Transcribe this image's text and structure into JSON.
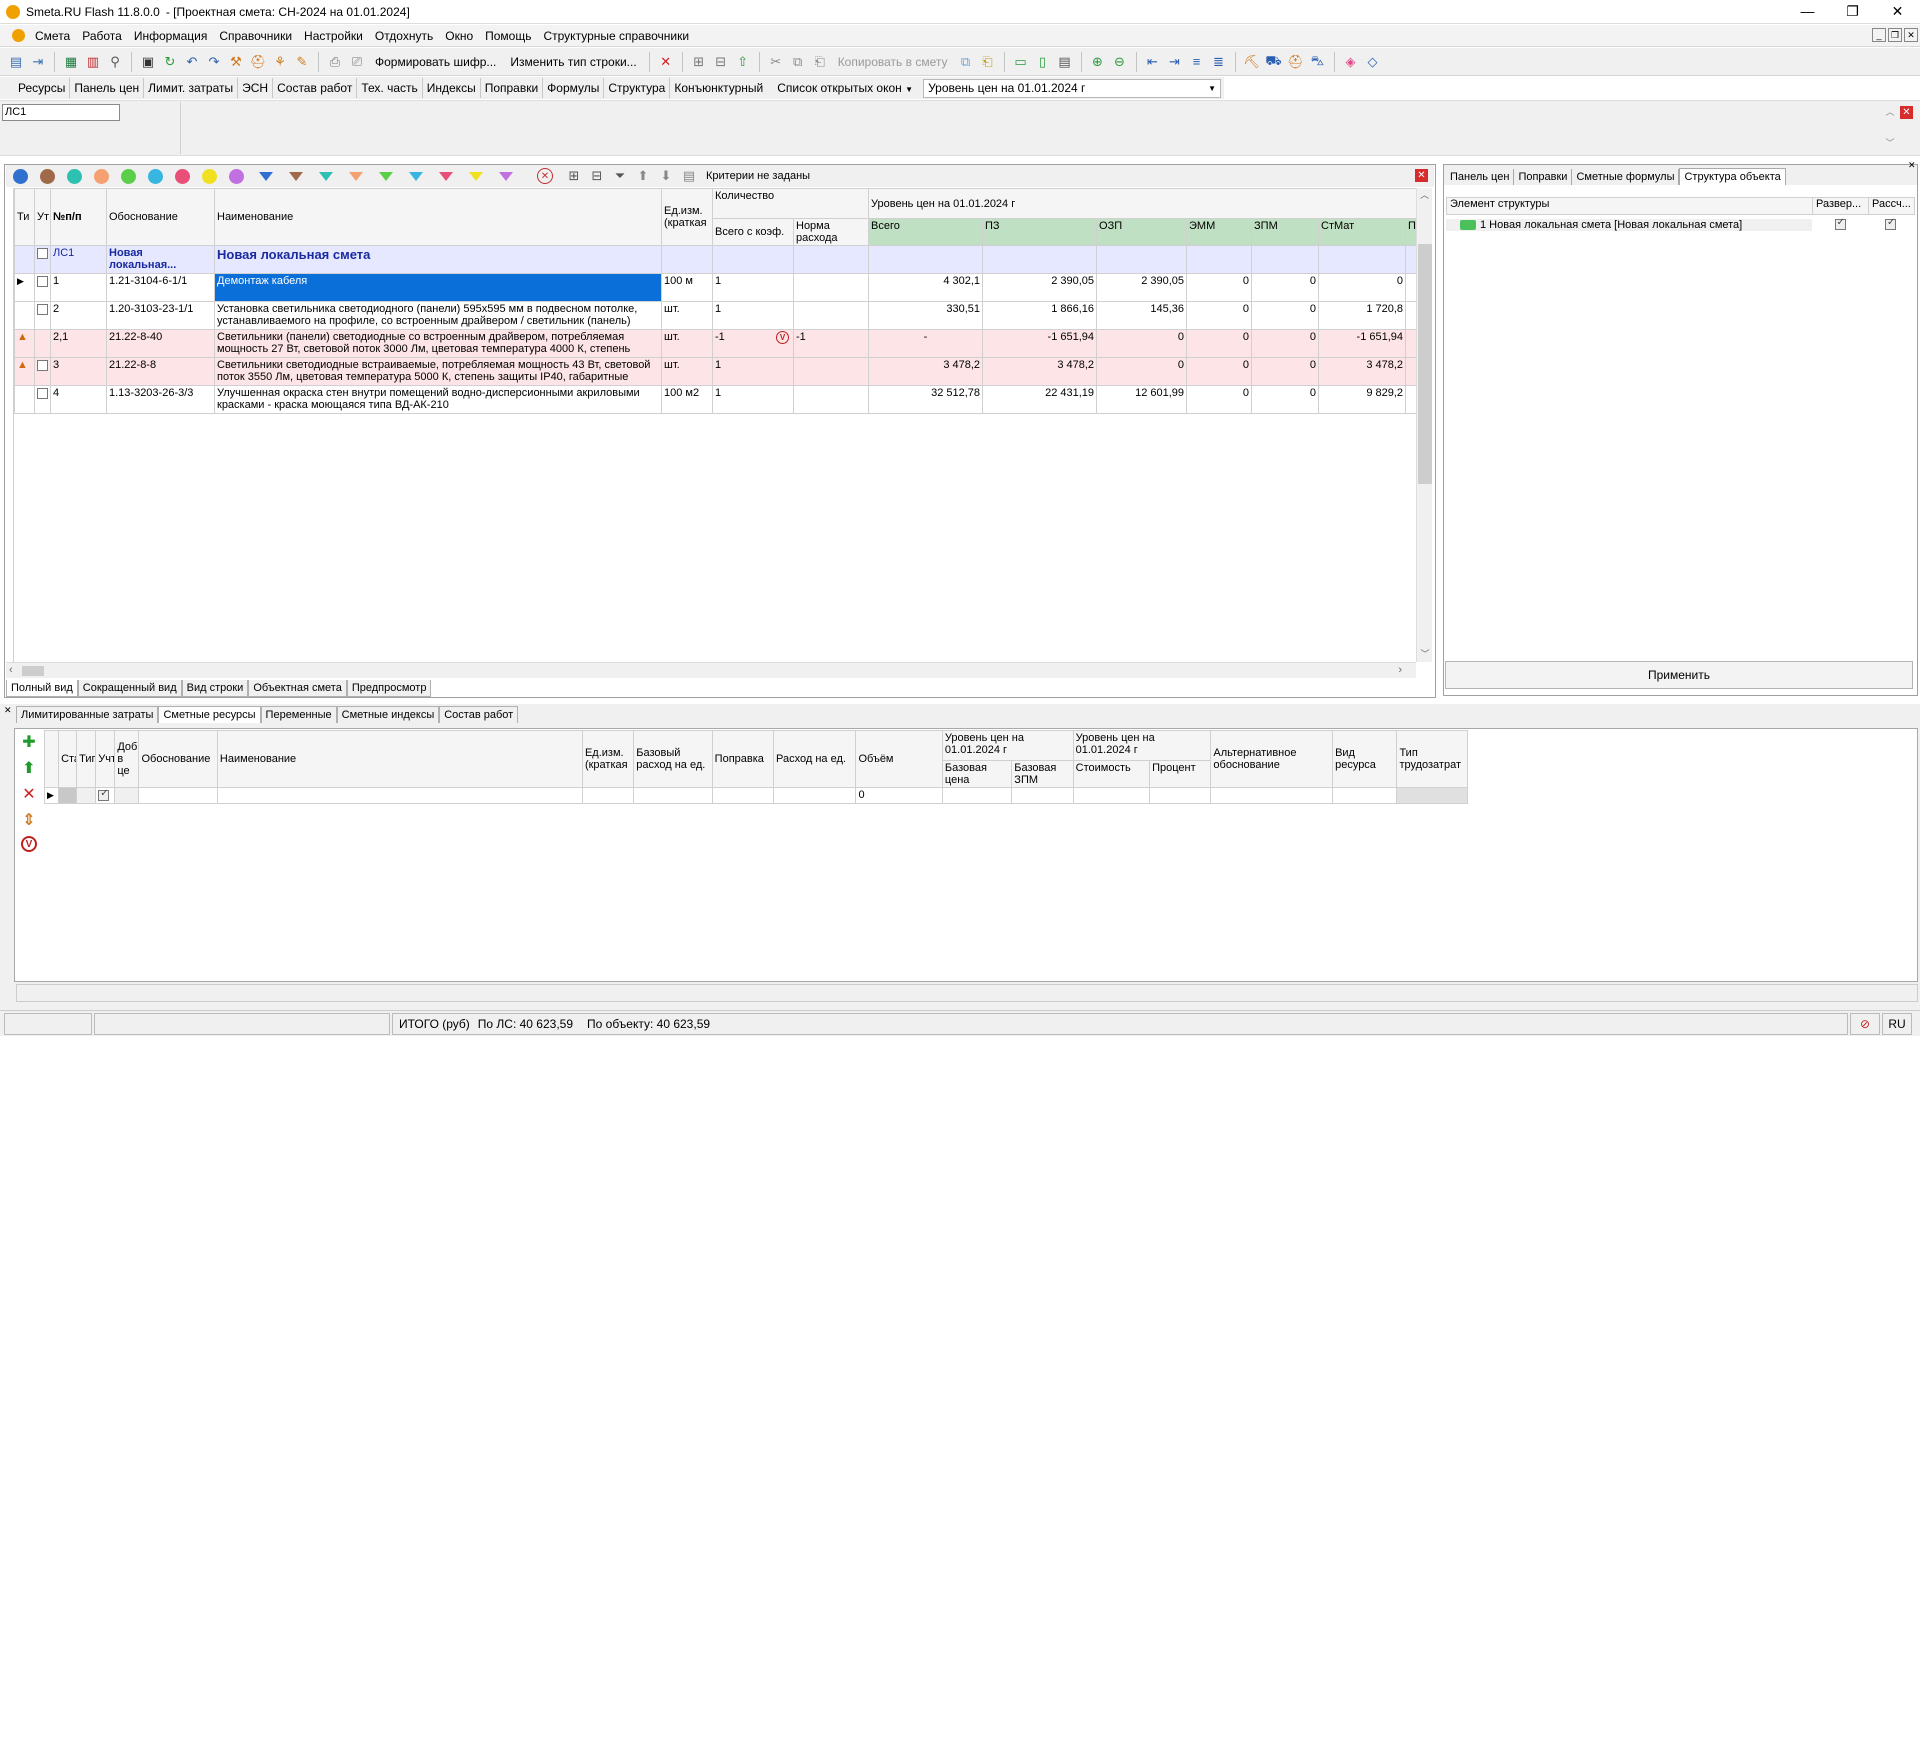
{
  "window": {
    "app_name": "Smeta.RU Flash  11.8.0.0",
    "doc_title": "- [Проектная смета: СН-2024 на 01.01.2024]",
    "controls": [
      "—",
      "❐",
      "✕"
    ]
  },
  "menu": {
    "items": [
      "Смета",
      "Работа",
      "Информация",
      "Справочники",
      "Настройки",
      "Отдохнуть",
      "Окно",
      "Помощь",
      "Структурные справочники"
    ]
  },
  "toolbar": {
    "form_cipher": "Формировать шифр...",
    "change_row_type": "Изменить тип строки...",
    "copy_to_estimate": "Копировать в смету"
  },
  "toolbar2": {
    "items": [
      "Ресурсы",
      "Панель цен",
      "Лимит. затраты",
      "ЭСН",
      "Состав работ",
      "Тех. часть",
      "Индексы",
      "Поправки",
      "Формулы",
      "Структура",
      "Конъюнктурный"
    ],
    "open_windows": "Список открытых окон",
    "price_level": "Уровень цен на 01.01.2024 г"
  },
  "doc_tab": {
    "label": "ЛС1"
  },
  "filterbar": {
    "colors": [
      "#2e6fd0",
      "#a06a4a",
      "#2ec0b0",
      "#f5a070",
      "#5ccf4a",
      "#36b6e0",
      "#e8507a",
      "#f0e020",
      "#c070e0"
    ],
    "funnel_colors": [
      "#2e6fd0",
      "#a06a4a",
      "#2ec0b0",
      "#f5a070",
      "#5ccf4a",
      "#36b6e0",
      "#e8507a",
      "#f0e020",
      "#c070e0"
    ],
    "criteria": "Критерии не заданы"
  },
  "grid": {
    "headers": {
      "type": "Ти",
      "ut": "Ут",
      "num": "№п/п",
      "basis": "Обоснование",
      "name": "Наименование",
      "unit": "Ед.изм. (краткая",
      "quantity": "Количество",
      "qty_total": "Всего с коэф.",
      "qty_norm": "Норма расхода",
      "price_level": "Уровень цен на 01.01.2024 г",
      "total": "Всего",
      "pz": "ПЗ",
      "ozp": "ОЗП",
      "emm": "ЭММ",
      "zpm": "ЗПМ",
      "stmat": "СтМат",
      "pr": "Пр"
    },
    "ls_row": {
      "num": "ЛС1",
      "basis": "Новая локальная...",
      "name": "Новая локальная смета"
    },
    "rows": [
      {
        "num": "1",
        "basis": "1.21-3104-6-1/1",
        "name": "Демонтаж кабеля",
        "unit": "100 м",
        "qty": "1",
        "norm": "",
        "total": "4 302,1",
        "pz": "2 390,05",
        "ozp": "2 390,05",
        "emm": "0",
        "zpm": "0",
        "stmat": "0"
      },
      {
        "num": "2",
        "basis": "1.20-3103-23-1/1",
        "name": "Установка светильника светодиодного (панели) 595x595 мм в подвесном потолке, устанавливаемого на профиле, со встроенным драйвером / светильник (панель)",
        "unit": "шт.",
        "qty": "1",
        "norm": "",
        "total": "330,51",
        "pz": "1 866,16",
        "ozp": "145,36",
        "emm": "0",
        "zpm": "0",
        "stmat": "1 720,8"
      },
      {
        "num": "2,1",
        "basis": "21.22-8-40",
        "name": "Светильники (панели) светодиодные со встроенным драйвером, потребляемая мощность 27 Вт, световой поток 3000 Лм, цветовая температура 4000 К, степень",
        "unit": "шт.",
        "qty": "-1",
        "norm": "-1",
        "total": "-",
        "pz": "-1 651,94",
        "ozp": "0",
        "emm": "0",
        "zpm": "0",
        "stmat": "-1 651,94"
      },
      {
        "num": "3",
        "basis": "21.22-8-8",
        "name": "Светильники светодиодные встраиваемые, потребляемая мощность 43 Вт, световой поток 3550 Лм, цветовая температура 5000 К, степень защиты IP40, габаритные",
        "unit": "шт.",
        "qty": "1",
        "norm": "",
        "total": "3 478,2",
        "pz": "3 478,2",
        "ozp": "0",
        "emm": "0",
        "zpm": "0",
        "stmat": "3 478,2"
      },
      {
        "num": "4",
        "basis": "1.13-3203-26-3/3",
        "name": "Улучшенная окраска стен внутри помещений водно-дисперсионными акриловыми красками - краска моющаяся типа ВД-АК-210",
        "unit": "100 м2",
        "qty": "1",
        "norm": "",
        "total": "32 512,78",
        "pz": "22 431,19",
        "ozp": "12 601,99",
        "emm": "0",
        "zpm": "0",
        "stmat": "9 829,2"
      }
    ]
  },
  "view_tabs": [
    "Полный вид",
    "Сокращенный вид",
    "Вид строки",
    "Объектная смета",
    "Предпросмотр"
  ],
  "right_panel": {
    "tabs": [
      "Панель цен",
      "Поправки",
      "Сметные формулы",
      "Структура объекта"
    ],
    "col_element": "Элемент структуры",
    "col_expand": "Развер...",
    "col_calc": "Рассч...",
    "tree_item": "1 Новая локальная смета [Новая локальная смета]",
    "apply": "Применить"
  },
  "lower_tabs": [
    "Лимитированные затраты",
    "Сметные ресурсы",
    "Переменные",
    "Сметные индексы",
    "Состав работ"
  ],
  "resources": {
    "headers": {
      "st": "Ста",
      "type": "Тиг",
      "uch": "Учт",
      "add": "Доб в це",
      "basis": "Обоснование",
      "name": "Наименование",
      "unit": "Ед.изм. (краткая",
      "base_rate": "Базовый расход на ед.",
      "correction": "Поправка",
      "rate": "Расход на ед.",
      "volume": "Объём",
      "level1": "Уровень цен на 01.01.2024 г",
      "base_price": "Базовая цена",
      "base_zpm": "Базовая ЗПМ",
      "level2": "Уровень цен на 01.01.2024 г",
      "cost": "Стоимость",
      "percent": "Процент",
      "alt_basis": "Альтернативное обоснование",
      "res_kind": "Вид ресурса",
      "labor_type": "Тип трудозатрат"
    },
    "row_volume": "0"
  },
  "status": {
    "total_label": "ИТОГО (руб)",
    "by_ls": "По ЛС: 40 623,59",
    "by_object": "По объекту: 40 623,59",
    "lang": "RU"
  }
}
